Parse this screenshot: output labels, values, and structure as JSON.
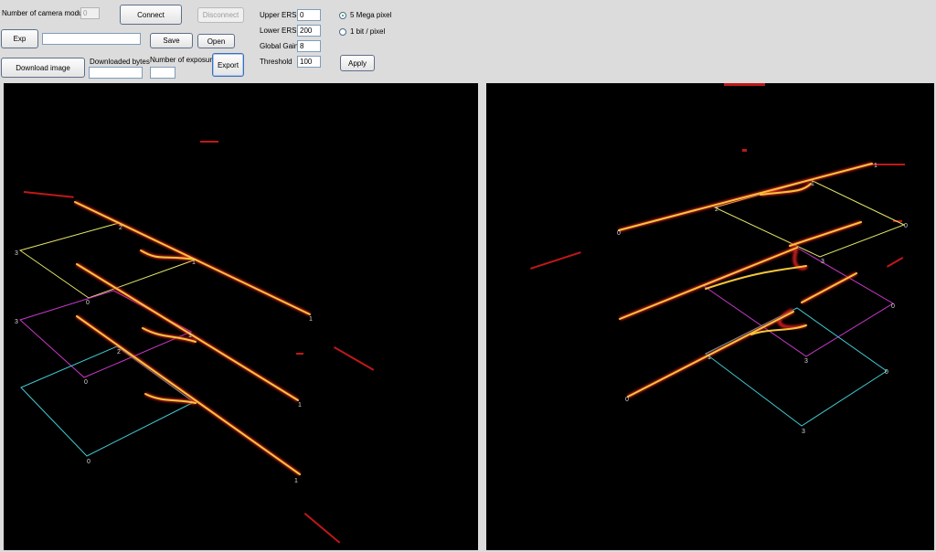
{
  "toolbar": {
    "camera_module_label": "Number of camera module:",
    "camera_module_value": "0",
    "connect_label": "Connect",
    "disconnect_label": "Disconnect",
    "exp_label": "Exp",
    "exp_value": "",
    "save_label": "Save",
    "open_label": "Open",
    "download_label": "Download image",
    "downloaded_bytes_label": "Downloaded bytes",
    "downloaded_bytes_value": "",
    "num_exposures_label": "Number of exposures",
    "num_exposures_value": "",
    "export_label": "Export"
  },
  "settings": {
    "upper_ers_label": "Upper ERS",
    "upper_ers_value": "0",
    "lower_ers_label": "Lower ERS",
    "lower_ers_value": "200",
    "global_gain_label": "Global Gain",
    "global_gain_value": "8",
    "threshold_label": "Threshold",
    "threshold_value": "100",
    "mode_5mp_label": "5 Mega pixel",
    "mode_1bit_label": "1 bit / pixel",
    "selected_mode": "5 Mega pixel",
    "apply_label": "Apply"
  },
  "colors": {
    "laser_line": "#f4c63a",
    "laser_glow": "#e02020",
    "grid_yellow": "#e6e66a",
    "grid_magenta": "#c838c8",
    "grid_cyan": "#40c8d0",
    "background": "#000000"
  },
  "views": {
    "left": {
      "frames": [
        {
          "color": "grid_yellow",
          "corner_labels": [
            "3",
            "2",
            "1",
            "0"
          ]
        },
        {
          "color": "grid_magenta",
          "corner_labels": [
            "3",
            "1",
            "0"
          ]
        },
        {
          "color": "grid_cyan",
          "corner_labels": [
            "2",
            "0"
          ]
        }
      ],
      "line_end_labels": [
        "1",
        "1",
        "1"
      ]
    },
    "right": {
      "frames": [
        {
          "color": "grid_yellow",
          "corner_labels": [
            "1",
            "2",
            "0",
            "3"
          ]
        },
        {
          "color": "grid_magenta",
          "corner_labels": [
            "0",
            "3"
          ]
        },
        {
          "color": "grid_cyan",
          "corner_labels": [
            "1",
            "0",
            "3"
          ]
        }
      ],
      "line_end_labels": [
        "0",
        "1",
        "0"
      ]
    }
  }
}
